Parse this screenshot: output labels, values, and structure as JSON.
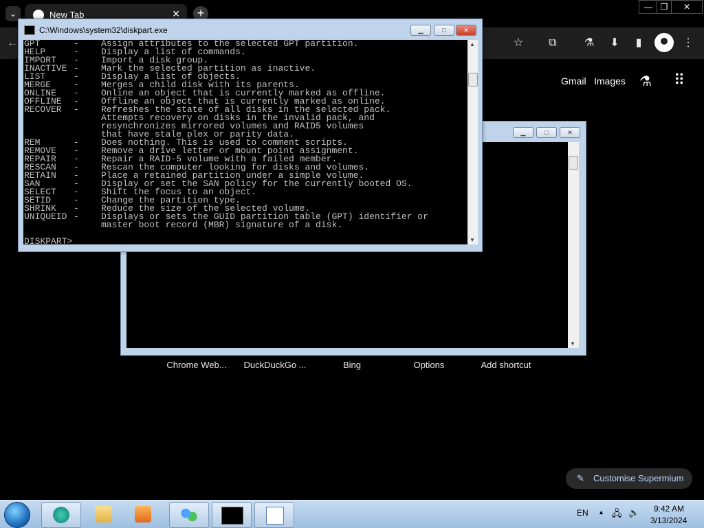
{
  "browser": {
    "tab_title": "New Tab",
    "tab_close": "✕",
    "new_tab": "+",
    "window_controls": {
      "minimize": "—",
      "restore": "❐",
      "close": "✕"
    },
    "toolbar": {
      "back": "←",
      "bookmark": "☆",
      "extensions": "⧉",
      "labs": "⚗",
      "download": "⬇",
      "sidebar": "▮"
    }
  },
  "ntp": {
    "links": {
      "gmail": "Gmail",
      "images": "Images"
    },
    "labs_icon": "⚗",
    "apps_icon": "⠿",
    "shortcuts": [
      "Chrome Web...",
      "DuckDuckGo ...",
      "Bing",
      "Options",
      "Add shortcut"
    ],
    "customise": "Customise Supermium",
    "customise_icon": "✎"
  },
  "diskpart_window": {
    "title": "C:\\Windows\\system32\\diskpart.exe",
    "lines": [
      {
        "cmd": "GPT",
        "dash": "-",
        "text": "Assign attributes to the selected GPT partition."
      },
      {
        "cmd": "HELP",
        "dash": "-",
        "text": "Display a list of commands."
      },
      {
        "cmd": "IMPORT",
        "dash": "-",
        "text": "Import a disk group."
      },
      {
        "cmd": "INACTIVE",
        "dash": "-",
        "text": "Mark the selected partition as inactive."
      },
      {
        "cmd": "LIST",
        "dash": "-",
        "text": "Display a list of objects."
      },
      {
        "cmd": "MERGE",
        "dash": "-",
        "text": "Merges a child disk with its parents."
      },
      {
        "cmd": "ONLINE",
        "dash": "-",
        "text": "Online an object that is currently marked as offline."
      },
      {
        "cmd": "OFFLINE",
        "dash": "-",
        "text": "Offline an object that is currently marked as online."
      },
      {
        "cmd": "RECOVER",
        "dash": "-",
        "text": "Refreshes the state of all disks in the selected pack."
      },
      {
        "cmd": "",
        "dash": "",
        "text": "Attempts recovery on disks in the invalid pack, and"
      },
      {
        "cmd": "",
        "dash": "",
        "text": "resynchronizes mirrored volumes and RAID5 volumes"
      },
      {
        "cmd": "",
        "dash": "",
        "text": "that have stale plex or parity data."
      },
      {
        "cmd": "REM",
        "dash": "-",
        "text": "Does nothing. This is used to comment scripts."
      },
      {
        "cmd": "REMOVE",
        "dash": "-",
        "text": "Remove a drive letter or mount point assignment."
      },
      {
        "cmd": "REPAIR",
        "dash": "-",
        "text": "Repair a RAID-5 volume with a failed member."
      },
      {
        "cmd": "RESCAN",
        "dash": "-",
        "text": "Rescan the computer looking for disks and volumes."
      },
      {
        "cmd": "RETAIN",
        "dash": "-",
        "text": "Place a retained partition under a simple volume."
      },
      {
        "cmd": "SAN",
        "dash": "-",
        "text": "Display or set the SAN policy for the currently booted OS."
      },
      {
        "cmd": "SELECT",
        "dash": "-",
        "text": "Shift the focus to an object."
      },
      {
        "cmd": "SETID",
        "dash": "-",
        "text": "Change the partition type."
      },
      {
        "cmd": "SHRINK",
        "dash": "-",
        "text": "Reduce the size of the selected volume."
      },
      {
        "cmd": "UNIQUEID",
        "dash": "-",
        "text": "Displays or sets the GUID partition table (GPT) identifier or"
      },
      {
        "cmd": "",
        "dash": "",
        "text": "master boot record (MBR) signature of a disk."
      },
      {
        "cmd": "",
        "dash": "",
        "text": ""
      },
      {
        "cmd": "DISKPART>",
        "dash": "",
        "text": ""
      }
    ]
  },
  "window_buttons": {
    "minimize": "▁",
    "maximize": "□",
    "close": "✕"
  },
  "taskbar": {
    "lang": "EN",
    "time": "9:42 AM",
    "date": "3/13/2024",
    "tray_icons": {
      "chevron": "▲",
      "network": "🖧",
      "volume": "🔈"
    }
  },
  "colors": {
    "console_bg": "#000000",
    "console_text": "#c0c0c0",
    "window_frame": "#bfd3ea",
    "taskbar": "#b6cde6"
  }
}
